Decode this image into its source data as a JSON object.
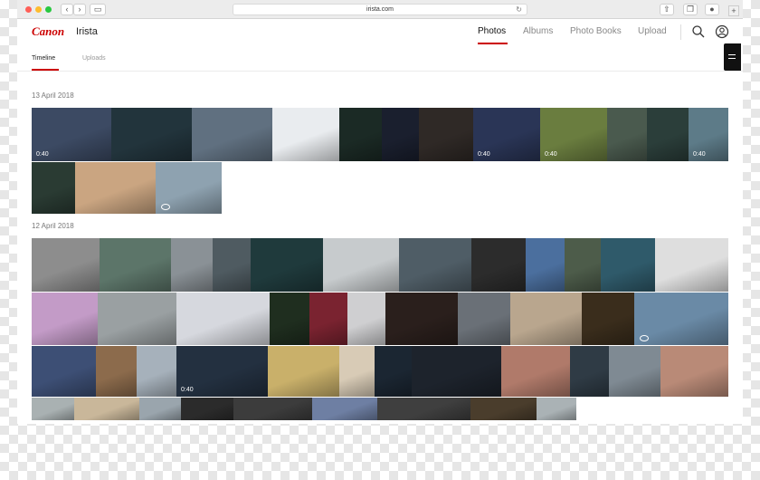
{
  "browser": {
    "url": "irista.com",
    "back_icon": "chevron-left-icon",
    "forward_icon": "chevron-right-icon"
  },
  "header": {
    "logo": "Canon",
    "app_name": "Irista",
    "nav": [
      {
        "label": "Photos",
        "active": true
      },
      {
        "label": "Albums",
        "active": false
      },
      {
        "label": "Photo Books",
        "active": false
      },
      {
        "label": "Upload",
        "active": false
      }
    ]
  },
  "subnav": {
    "tabs": [
      {
        "label": "Timeline",
        "active": true
      },
      {
        "label": "Uploads",
        "active": false
      }
    ]
  },
  "sections": [
    {
      "date": "13 April 2018",
      "photos": [
        {
          "duration": "0:40"
        },
        {},
        {},
        {},
        {},
        {},
        {},
        {
          "duration": "0:40"
        },
        {
          "duration": "0:40"
        },
        {},
        {},
        {
          "duration": "0:40"
        },
        {},
        {},
        {
          "rotate": true
        }
      ]
    },
    {
      "date": "12 April 2018",
      "photos": [
        {},
        {},
        {},
        {},
        {},
        {},
        {},
        {},
        {},
        {},
        {},
        {},
        {},
        {},
        {},
        {},
        {},
        {},
        {},
        {},
        {},
        {},
        {
          "rotate": true
        },
        {},
        {},
        {},
        {
          "duration": "0:40"
        },
        {},
        {},
        {},
        {},
        {},
        {},
        {},
        {},
        {},
        {},
        {},
        {},
        {},
        {},
        {},
        {},
        {}
      ]
    }
  ],
  "colors": {
    "accent": "#cc0000"
  }
}
